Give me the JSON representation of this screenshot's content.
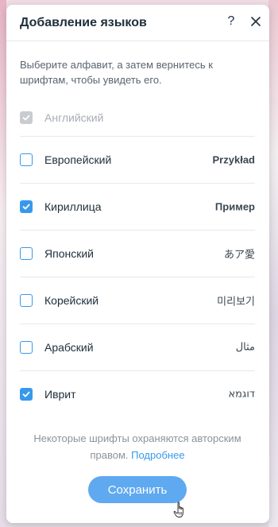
{
  "dialog": {
    "title": "Добавление языков",
    "help_label": "?",
    "close_icon": "close-icon",
    "intro_text": "Выберите алфавит, а затем вернитесь к шрифтам, чтобы увидеть его."
  },
  "languages": [
    {
      "label": "Английский",
      "sample": "",
      "checked": true,
      "disabled": true
    },
    {
      "label": "Европейский",
      "sample": "Przykład",
      "checked": false,
      "disabled": false
    },
    {
      "label": "Кириллица",
      "sample": "Пример",
      "checked": true,
      "disabled": false
    },
    {
      "label": "Японский",
      "sample": "あア愛",
      "checked": false,
      "disabled": false
    },
    {
      "label": "Корейский",
      "sample": "미리보기",
      "checked": false,
      "disabled": false
    },
    {
      "label": "Арабский",
      "sample": "مثال",
      "checked": false,
      "disabled": false
    },
    {
      "label": "Иврит",
      "sample": "דוגמא",
      "checked": true,
      "disabled": false
    }
  ],
  "footer": {
    "note_text": "Некоторые шрифты охраняются авторским правом.",
    "link_text": "Подробнее"
  },
  "actions": {
    "save_label": "Сохранить"
  },
  "colors": {
    "accent": "#3899ec",
    "save_button": "#5fa9f0",
    "disabled": "#c8cbd0",
    "title_text": "#20303c"
  }
}
